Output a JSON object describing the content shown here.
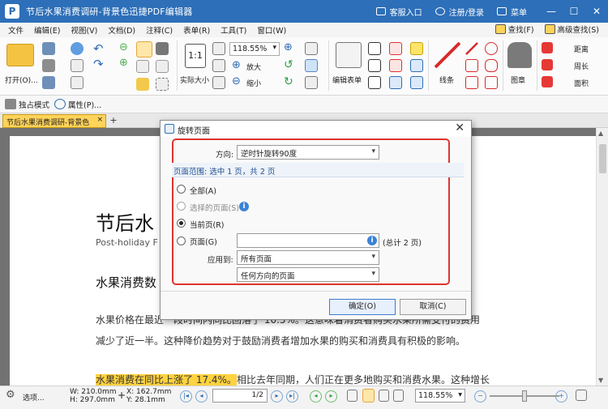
{
  "titlebar": {
    "app_icon_letter": "P",
    "title": "节后水果消费调研-背景色迅捷PDF编辑器",
    "service": "客服入口",
    "account": "注册/登录",
    "menu": "菜单",
    "minimize": "—",
    "maximize": "☐",
    "close": "✕"
  },
  "menubar": {
    "items": [
      "文件",
      "编辑(E)",
      "视图(V)",
      "文档(D)",
      "注释(C)",
      "表单(R)",
      "工具(T)",
      "窗口(W)"
    ],
    "find": "查找(F)",
    "advanced_find": "高级查找(S)"
  },
  "ribbon": {
    "open": "打开(O)...",
    "actual_size": "实际大小",
    "zoom_value": "118.55%",
    "zoom_in": "放大",
    "zoom_out": "缩小",
    "edit_form": "编辑表单",
    "line": "线条",
    "stamp": "图章",
    "distance": "距离",
    "perimeter": "周长",
    "area": "面积"
  },
  "quicktools": {
    "exclusive_mode": "独占模式",
    "properties": "属性(P)..."
  },
  "tabs": {
    "doc_tab": "节后水果消费调研-背景色",
    "close_tab": "×",
    "add_tab": "+"
  },
  "document": {
    "title": "节后水",
    "subtitle": "Post-holiday F",
    "heading": "水果消费数",
    "para1_a": "水果价格在最近一段时间内同比回落了 10.5%。这意味着消费者购买水果所需支付的费用",
    "para1_b": "减少了近一半。这种降价趋势对于鼓励消费者增加水果的购买和消费具有积极的影响。",
    "para2_highlight": "水果消费在同比上涨了 17.4%。",
    "para2_rest": "相比去年同期，人们正在更多地购买和消费水果。这种增长"
  },
  "dialog": {
    "title": "旋转页面",
    "direction_label": "方向:",
    "direction_value": "逆时针旋转90度",
    "range_label": "页面范围: 选中 1 页，共 2 页",
    "opt_all": "全部(A)",
    "opt_selected": "选择的页面(S)",
    "opt_current": "当前页(R)",
    "opt_pages": "页面(G)",
    "pages_input": "",
    "total": "(总计 2 页)",
    "apply_label": "应用到:",
    "apply_value": "所有页面",
    "orientation_value": "任何方向的页面",
    "ok": "确定(O)",
    "cancel": "取消(C)",
    "selected_option": "current"
  },
  "statusbar": {
    "options": "选项...",
    "width": "W: 210.0mm",
    "height": "H: 297.0mm",
    "x": "X: 162.7mm",
    "y": "Y: 28.1mm",
    "page_display": "1/2",
    "zoom": "118.55%"
  },
  "colors": {
    "titlebar": "#2d6fb8",
    "tab_active": "#ffd35a",
    "highlight": "#ffd23f",
    "red_frame": "#e0342c"
  }
}
